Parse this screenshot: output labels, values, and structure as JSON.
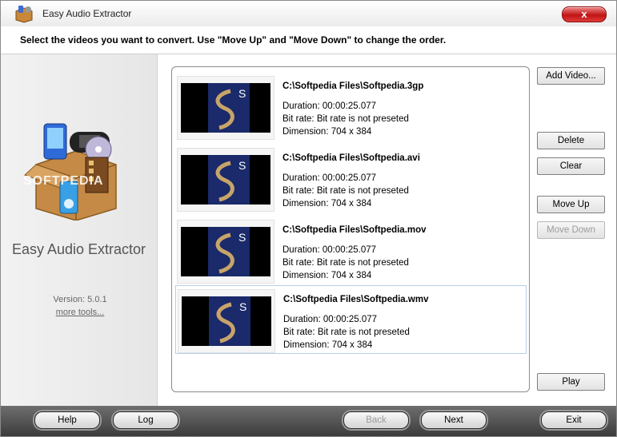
{
  "window": {
    "title": "Easy Audio Extractor",
    "close_label": "x"
  },
  "instructions": "Select the videos you want to convert. Use \"Move Up\" and \"Move Down\" to change the order.",
  "sidebar": {
    "app_name": "Easy Audio Extractor",
    "watermark": "SOFTPEDIA",
    "version": "Version: 5.0.1",
    "more_tools": "more tools..."
  },
  "videos": [
    {
      "path": "C:\\Softpedia Files\\Softpedia.3gp",
      "duration": "Duration: 00:00:25.077",
      "bitrate": "Bit rate: Bit rate is not preseted",
      "dimension": "Dimension: 704 x 384"
    },
    {
      "path": "C:\\Softpedia Files\\Softpedia.avi",
      "duration": "Duration: 00:00:25.077",
      "bitrate": "Bit rate: Bit rate is not preseted",
      "dimension": "Dimension: 704 x 384"
    },
    {
      "path": "C:\\Softpedia Files\\Softpedia.mov",
      "duration": "Duration: 00:00:25.077",
      "bitrate": "Bit rate: Bit rate is not preseted",
      "dimension": "Dimension: 704 x 384"
    },
    {
      "path": "C:\\Softpedia Files\\Softpedia.wmv",
      "duration": "Duration: 00:00:25.077",
      "bitrate": "Bit rate: Bit rate is not preseted",
      "dimension": "Dimension: 704 x 384"
    }
  ],
  "thumbnail_letter": "S",
  "actions": {
    "add_video": "Add Video...",
    "delete": "Delete",
    "clear": "Clear",
    "move_up": "Move Up",
    "move_down": "Move Down",
    "play": "Play"
  },
  "footer": {
    "help": "Help",
    "log": "Log",
    "back": "Back",
    "next": "Next",
    "exit": "Exit"
  },
  "colors": {
    "close_button": "#c01414",
    "footer_bar": "#4a4a4a",
    "selection_border": "#b8cee6"
  }
}
